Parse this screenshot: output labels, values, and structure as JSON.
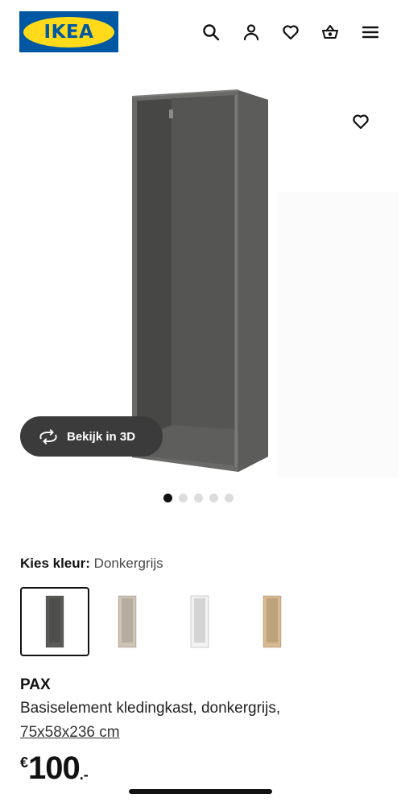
{
  "header": {
    "logo_text": "IKEA",
    "icons": [
      "search-icon",
      "account-icon",
      "favorites-icon",
      "basket-icon",
      "menu-icon"
    ]
  },
  "gallery": {
    "view_3d_label": "Bekijk in 3D",
    "dots_count": 5,
    "active_dot": 1
  },
  "color_picker": {
    "label": "Kies kleur:",
    "selected_value": "Donkergrijs",
    "options": [
      {
        "name": "donkergrijs",
        "color": "#5a5a58",
        "selected": true
      },
      {
        "name": "beige",
        "color": "#cdc4b4",
        "selected": false
      },
      {
        "name": "wit",
        "color": "#f2f2f2",
        "selected": false
      },
      {
        "name": "eikeneffect",
        "color": "#d9b98d",
        "selected": false
      }
    ]
  },
  "product": {
    "brand": "PAX",
    "description": "Basiselement kledingkast, donkergrijs,",
    "dimensions": "75x58x236 cm",
    "price": {
      "currency": "€",
      "integer": "100",
      "decimal": ".-"
    }
  },
  "colors": {
    "ikea_blue": "#0058a3",
    "ikea_yellow": "#ffda1a",
    "view3d_bg": "#3b3b3b"
  }
}
